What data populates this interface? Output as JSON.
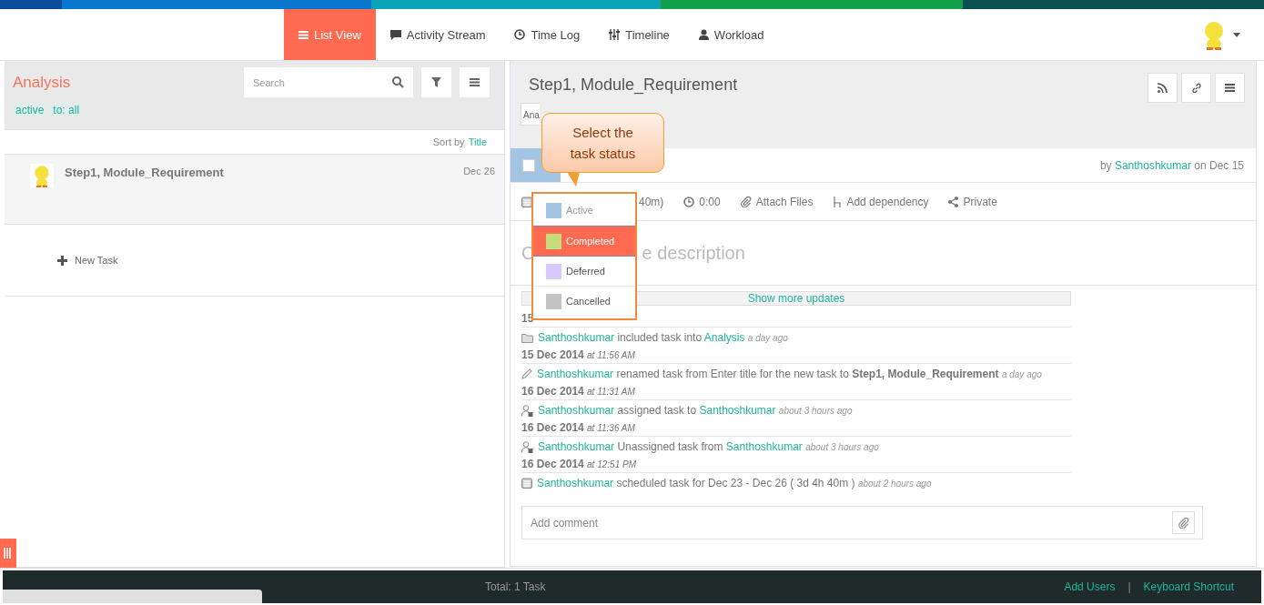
{
  "nav": {
    "tabs": [
      {
        "label": "List View",
        "selected": true
      },
      {
        "label": "Activity Stream",
        "selected": false
      },
      {
        "label": "Time Log",
        "selected": false
      },
      {
        "label": "Timeline",
        "selected": false
      },
      {
        "label": "Workload",
        "selected": false
      }
    ]
  },
  "list_pane": {
    "title": "Analysis",
    "search": {
      "placeholder": "Search"
    },
    "filters": [
      "active",
      "to: all"
    ],
    "sort_label": "Sort by",
    "sort_field": "Title",
    "tasks": [
      {
        "title": "Step1, Module_Requirement",
        "date": "Dec 26"
      }
    ],
    "new_task": "New Task"
  },
  "detail": {
    "title": "Step1, Module_Requirement",
    "project_select": "Ana",
    "checked": false,
    "author_prefix": "by",
    "author": "Santhoshkumar",
    "date_suffix": "on Dec 15",
    "schedule": "40m)",
    "time_spent": "0:00",
    "actions": [
      "Attach Files",
      "Add dependency",
      "Private"
    ],
    "description_fragments": [
      "C",
      "e description"
    ],
    "show_more": "Show more updates",
    "history": [
      {
        "date": "15",
        "kind": "included",
        "segments": [
          {
            "kind": "user",
            "text": "Santhoshkumar"
          },
          {
            "kind": "plain",
            "text": "included task into"
          },
          {
            "kind": "user",
            "text": "Analysis"
          }
        ],
        "ago": "a day ago"
      },
      {
        "date": "15 Dec 2014",
        "time": "at 11:56 AM",
        "kind": "renamed",
        "segments": [
          {
            "kind": "user",
            "text": "Santhoshkumar"
          },
          {
            "kind": "plain",
            "text": "renamed task from Enter title for the new task to **Step1, Module_Requirement**"
          }
        ],
        "ago": "a day ago"
      },
      {
        "date": "16 Dec 2014",
        "time": "at 11:31 AM",
        "kind": "assigned",
        "segments": [
          {
            "kind": "user",
            "text": "Santhoshkumar"
          },
          {
            "kind": "plain",
            "text": "assigned task to"
          },
          {
            "kind": "user",
            "text": "Santhoshkumar"
          }
        ],
        "ago": "about 3 hours ago"
      },
      {
        "date": "16 Dec 2014",
        "time": "at 11:36 AM",
        "kind": "assigned",
        "segments": [
          {
            "kind": "user",
            "text": "Santhoshkumar"
          },
          {
            "kind": "plain",
            "text": "Unassigned task from"
          },
          {
            "kind": "user",
            "text": "Santhoshkumar"
          }
        ],
        "ago": "about 3 hours ago"
      },
      {
        "date": "16 Dec 2014",
        "time": "at 12:51 PM",
        "kind": "scheduled",
        "segments": [
          {
            "kind": "user",
            "text": "Santhoshkumar"
          },
          {
            "kind": "plain",
            "text": "scheduled task for Dec 23 - Dec 26 ( 3d 4h 40m )"
          }
        ],
        "ago": "about 2 hours ago"
      }
    ],
    "comment": {
      "placeholder": "Add comment"
    }
  },
  "status_menu": {
    "options": [
      {
        "label": "Active",
        "color": "#a4c4e4",
        "selected": false
      },
      {
        "label": "Completed",
        "color": "#c5dc7c",
        "selected": true
      },
      {
        "label": "Deferred",
        "color": "#d8c8fb",
        "selected": false
      },
      {
        "label": "Cancelled",
        "color": "#c4c4c4",
        "selected": false
      }
    ]
  },
  "callout": {
    "text": "Select the task status"
  },
  "footer": {
    "total": "Total: 1 Task",
    "links": [
      "Add Users",
      "Keyboard Shortcut"
    ],
    "separator": "|"
  }
}
